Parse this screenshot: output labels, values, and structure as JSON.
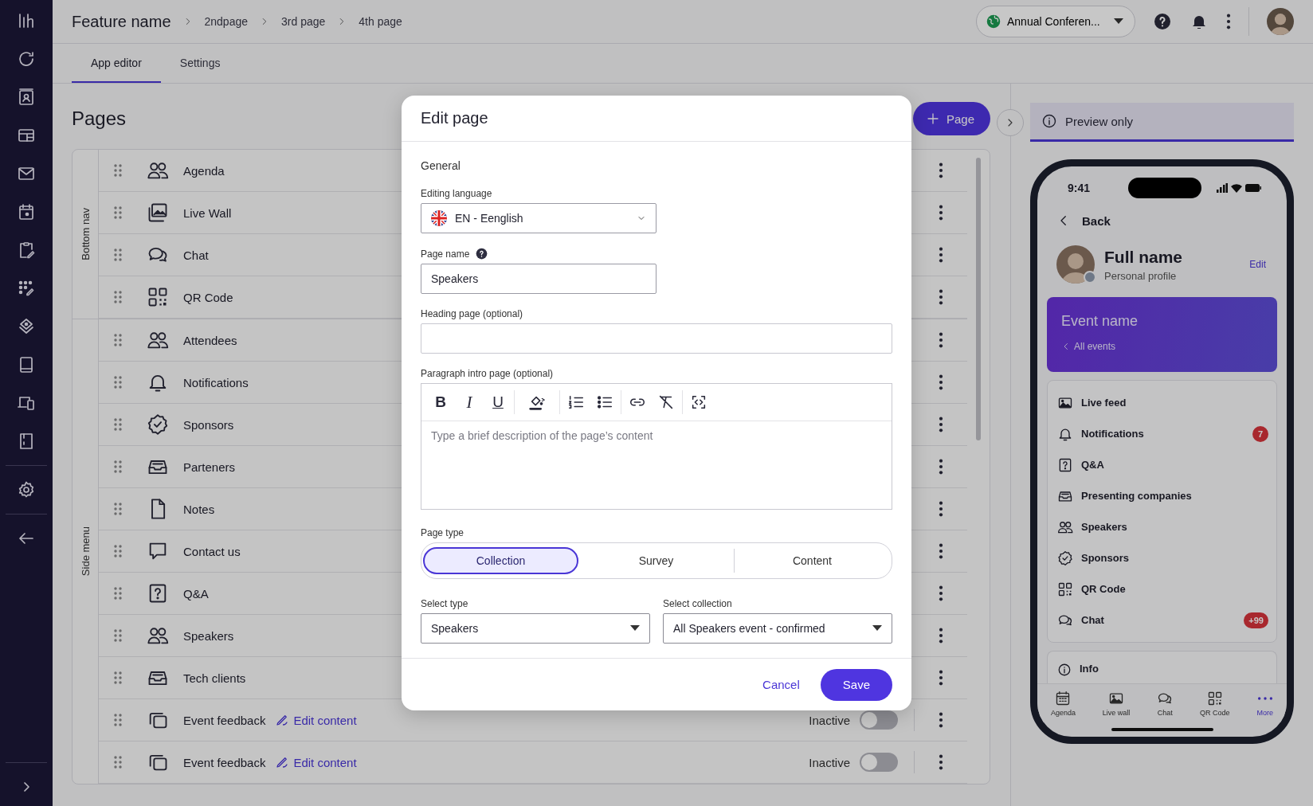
{
  "header": {
    "title": "Feature name",
    "breadcrumbs": [
      "2ndpage",
      "3rd page",
      "4th page"
    ],
    "event_selector": "Annual Conferen..."
  },
  "tabs": [
    {
      "label": "App editor",
      "selected": true
    },
    {
      "label": "Settings",
      "selected": false
    }
  ],
  "pages": {
    "title": "Pages",
    "add_button": "Page",
    "sections": [
      {
        "label": "Bottom nav",
        "rows": [
          {
            "name": "Agenda",
            "kind": "people"
          },
          {
            "name": "Live Wall",
            "kind": "gallery"
          },
          {
            "name": "Chat",
            "kind": "chat"
          },
          {
            "name": "QR Code",
            "kind": "qr"
          }
        ]
      },
      {
        "label": "Side menu",
        "rows": [
          {
            "name": "Attendees",
            "kind": "people"
          },
          {
            "name": "Notifications",
            "kind": "bell"
          },
          {
            "name": "Sponsors",
            "kind": "badge"
          },
          {
            "name": "Parteners",
            "kind": "inbox"
          },
          {
            "name": "Notes",
            "kind": "file"
          },
          {
            "name": "Contact us",
            "kind": "comment"
          },
          {
            "name": "Q&A",
            "kind": "question"
          },
          {
            "name": "Speakers",
            "kind": "people"
          },
          {
            "name": "Tech clients",
            "kind": "inbox"
          },
          {
            "name": "Event feedback",
            "kind": "cards",
            "link": "Edit content",
            "status": "Inactive",
            "on": false
          },
          {
            "name": "Event feedback",
            "kind": "cards",
            "link": "Edit content",
            "status": "Inactive",
            "on": false
          }
        ]
      }
    ]
  },
  "preview": {
    "banner": "Preview only",
    "phone": {
      "time": "9:41",
      "back": "Back",
      "profile": {
        "name": "Full name",
        "subtitle": "Personal profile",
        "action": "Edit"
      },
      "event": {
        "title": "Event name",
        "link": "All events"
      },
      "menu": [
        {
          "label": "Live feed",
          "kind": "image"
        },
        {
          "label": "Notifications",
          "kind": "bell",
          "badge": "7"
        },
        {
          "label": "Q&A",
          "kind": "question"
        },
        {
          "label": "Presenting companies",
          "kind": "inbox"
        },
        {
          "label": "Speakers",
          "kind": "people"
        },
        {
          "label": "Sponsors",
          "kind": "badge"
        },
        {
          "label": "QR Code",
          "kind": "qr"
        },
        {
          "label": "Chat",
          "kind": "chat",
          "badge": "+99"
        }
      ],
      "info": "Info",
      "bottom_nav": [
        {
          "label": "Agenda",
          "kind": "calendar",
          "selected": false
        },
        {
          "label": "Live wall",
          "kind": "image",
          "selected": false
        },
        {
          "label": "Chat",
          "kind": "chat",
          "selected": false
        },
        {
          "label": "QR Code",
          "kind": "qr",
          "selected": false
        },
        {
          "label": "More",
          "kind": "dots",
          "selected": true
        }
      ]
    }
  },
  "dialog": {
    "title": "Edit page",
    "section": "General",
    "language": {
      "label": "Editing language",
      "value": "EN - Eenglish"
    },
    "page_name": {
      "label": "Page name",
      "value": "Speakers"
    },
    "heading": {
      "label": "Heading page (optional)"
    },
    "intro": {
      "label": "Paragraph intro page (optional)",
      "format_buttons": [
        {
          "kind": "bold",
          "glyph": "B"
        },
        {
          "kind": "italic",
          "glyph": "I"
        },
        {
          "kind": "underline",
          "glyph": "U"
        }
      ],
      "placeholder": "Type a brief description of the page’s content"
    },
    "page_type": {
      "label": "Page type",
      "options": [
        {
          "label": "Collection",
          "selected": true
        },
        {
          "label": "Survey",
          "selected": false
        },
        {
          "label": "Content",
          "selected": false
        }
      ]
    },
    "select_type": {
      "label": "Select type",
      "value": "Speakers"
    },
    "select_collection": {
      "label": "Select collection",
      "value": "All Speakers event - confirmed"
    },
    "cancel": "Cancel",
    "save": "Save"
  }
}
